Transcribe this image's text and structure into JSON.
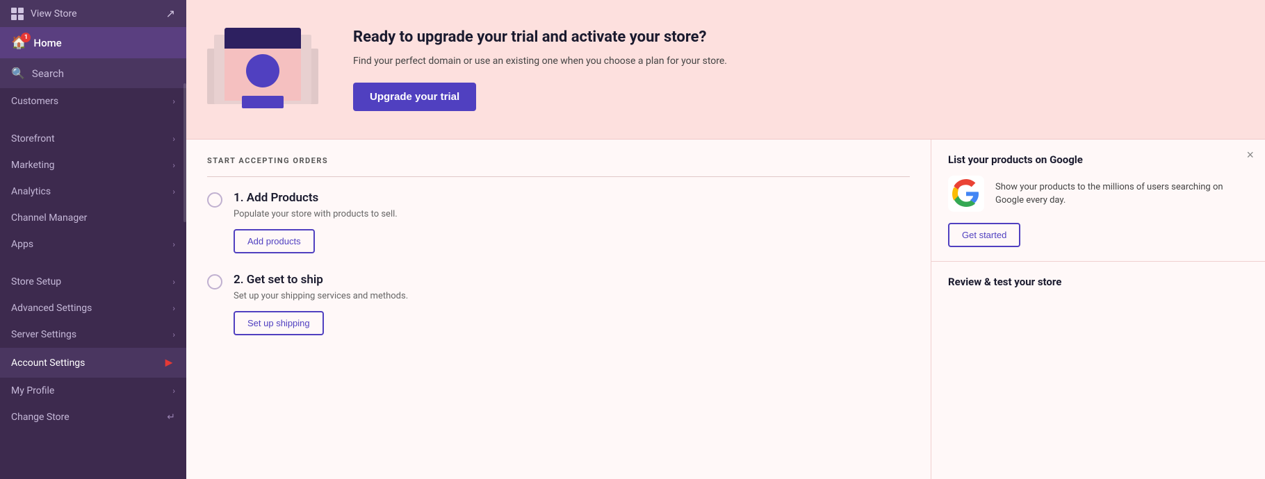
{
  "sidebar": {
    "view_store": "View Store",
    "home": "Home",
    "home_notification": "1",
    "search": "Search",
    "items_top": [
      {
        "id": "customers",
        "label": "Customers",
        "has_chevron": true
      }
    ],
    "items_main": [
      {
        "id": "storefront",
        "label": "Storefront",
        "has_chevron": true
      },
      {
        "id": "marketing",
        "label": "Marketing",
        "has_chevron": true
      },
      {
        "id": "analytics",
        "label": "Analytics",
        "has_chevron": true
      },
      {
        "id": "channel-manager",
        "label": "Channel Manager",
        "has_chevron": false
      },
      {
        "id": "apps",
        "label": "Apps",
        "has_chevron": true
      }
    ],
    "items_settings": [
      {
        "id": "store-setup",
        "label": "Store Setup",
        "has_chevron": true
      },
      {
        "id": "advanced-settings",
        "label": "Advanced Settings",
        "has_chevron": true
      },
      {
        "id": "server-settings",
        "label": "Server Settings",
        "has_chevron": true
      },
      {
        "id": "account-settings",
        "label": "Account Settings",
        "has_chevron": true,
        "active": true,
        "has_red_arrow": true
      },
      {
        "id": "my-profile",
        "label": "My Profile",
        "has_chevron": true
      },
      {
        "id": "change-store",
        "label": "Change Store",
        "has_chevron": false,
        "has_change_icon": true
      }
    ]
  },
  "hero": {
    "title": "Ready to upgrade your trial and activate your store?",
    "subtitle": "Find your perfect domain or use an existing one when you choose a plan for your store.",
    "upgrade_btn": "Upgrade your trial"
  },
  "orders": {
    "section_title": "START ACCEPTING ORDERS",
    "steps": [
      {
        "number": "1.",
        "title": "Add Products",
        "desc": "Populate your store with products to sell.",
        "btn_label": "Add products"
      },
      {
        "number": "2.",
        "title": "Get set to ship",
        "desc": "Set up your shipping services and methods.",
        "btn_label": "Set up shipping"
      }
    ]
  },
  "google_panel": {
    "title": "List your products on Google",
    "text": "Show your products to the millions of users searching on Google every day.",
    "btn_label": "Get started",
    "close_icon": "×"
  },
  "review_panel": {
    "title": "Review & test your store"
  }
}
